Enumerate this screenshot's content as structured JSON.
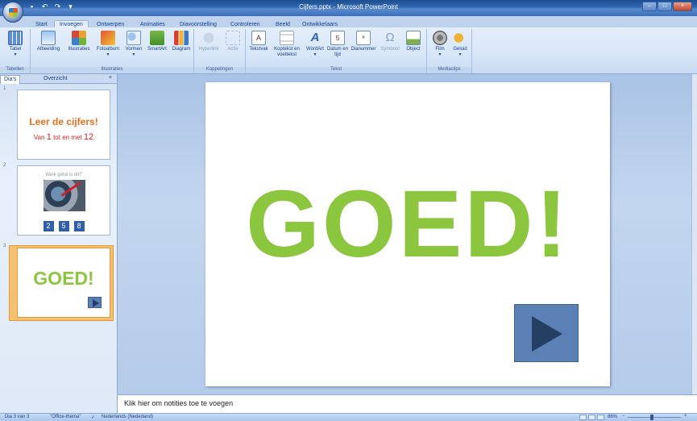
{
  "window": {
    "title": "Cijfers.pptx - Microsoft PowerPoint"
  },
  "ribbon": {
    "tabs": [
      "Start",
      "Invoegen",
      "Ontwerpen",
      "Animaties",
      "Diavoorstelling",
      "Controleren",
      "Beeld",
      "Ontwikkelaars"
    ],
    "active_tab": "Invoegen",
    "groups": {
      "tabellen": {
        "label": "Tabellen",
        "buttons": [
          "Tabel"
        ]
      },
      "illustraties": {
        "label": "Illustraties",
        "buttons": [
          "Afbeelding",
          "Illustraties",
          "Fotoalbum",
          "Vormen",
          "SmartArt",
          "Diagram"
        ]
      },
      "koppelingen": {
        "label": "Koppelingen",
        "buttons": [
          "Hyperlink",
          "Actie"
        ]
      },
      "tekst": {
        "label": "Tekst",
        "buttons": [
          "Tekstvak",
          "Koptekst en voettekst",
          "WordArt",
          "Datum en tijd",
          "Dianummer",
          "Symbool",
          "Object"
        ]
      },
      "mediaclips": {
        "label": "Mediaclips",
        "buttons": [
          "Film",
          "Geluid"
        ]
      }
    }
  },
  "leftpane": {
    "tabs": [
      "Dia's",
      "Overzicht"
    ],
    "close": "×",
    "slides": [
      {
        "number": "1",
        "title": "Leer de cijfers!",
        "subtitle_pre": "Van ",
        "subtitle_n1": "1",
        "subtitle_mid": " tot en met ",
        "subtitle_n2": "12"
      },
      {
        "number": "2",
        "title": "Welk getal is dit?",
        "numbers": [
          "2",
          "5",
          "8"
        ]
      },
      {
        "number": "3",
        "title": "GOED!"
      }
    ],
    "selected_slide": 3
  },
  "slide": {
    "title": "GOED!"
  },
  "notes": {
    "placeholder": "Klik hier om notities toe te voegen"
  },
  "status": {
    "slide_info": "Dia 3 van 3",
    "theme": "\"Office-thema\"",
    "language": "Nederlands (Nederland)",
    "zoom": "86%"
  },
  "colors": {
    "title_green": "#8cc63f",
    "button_blue": "#5a80b6",
    "selection_orange": "#f6c072"
  }
}
